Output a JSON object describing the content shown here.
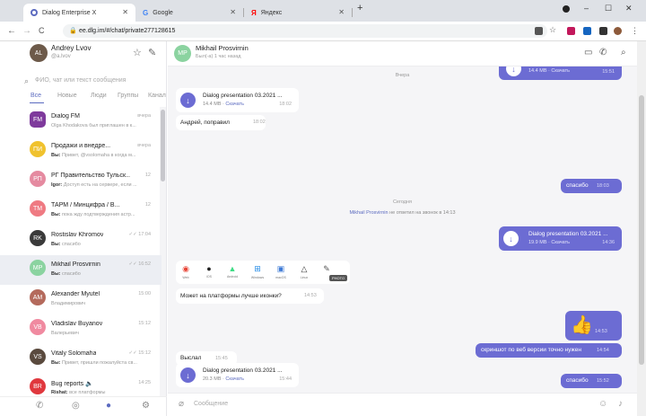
{
  "browser": {
    "tabs": [
      {
        "label": "Dialog Enterprise X",
        "fav_color": "#5c6bc0"
      },
      {
        "label": "Google",
        "fav_color": "#4285f4"
      },
      {
        "label": "Яндекс",
        "fav_color": "#ff0000"
      }
    ],
    "new_tab": "+",
    "url": "ee.dlg.im/#/chat/private277128615",
    "window_controls": {
      "min": "–",
      "max": "☐",
      "close": "✕"
    },
    "nav": {
      "back": "←",
      "forward": "→",
      "reload": "C"
    }
  },
  "me": {
    "name": "Andrey Lvov",
    "handle": "@a.lvov",
    "initials": "AL",
    "avatar_color": "#6d5a4a"
  },
  "search": {
    "placeholder": "ФИО, чат или текст сообщения"
  },
  "filters": [
    {
      "label": "Все",
      "active": true
    },
    {
      "label": "Новые",
      "active": false
    },
    {
      "label": "Люди",
      "active": false
    },
    {
      "label": "Группы",
      "active": false
    },
    {
      "label": "Канал",
      "active": false
    }
  ],
  "chats": [
    {
      "name": "Dialog FM",
      "preview": "Olga Khodakova был приглашен в к...",
      "time": "вчера",
      "initials": "FM",
      "color": "#7e3a9c"
    },
    {
      "name": "Продажи и внедре...",
      "preview_author": "Вы:",
      "preview": "Привет, @vsolomaha в когда м...",
      "time": "вчера",
      "initials": "ПИ",
      "color": "#f0c22e"
    },
    {
      "name": "РГ Правительство Тульск...",
      "preview_author": "Igor:",
      "preview": "Доступ есть на сервере, если ...",
      "time": "12",
      "initials": "РП",
      "color": "#e58aa0"
    },
    {
      "name": "ТАРМ / Минцифра / В...",
      "preview_author": "Вы:",
      "preview": "пока жду подтверждения астр...",
      "time": "12",
      "initials": "ТМ",
      "color": "#ef7a82"
    },
    {
      "name": "Rostislav Khromov",
      "preview_author": "Вы:",
      "preview": "спасибо",
      "time": "17:04",
      "initials": "RK",
      "color": "#3a3a3a"
    },
    {
      "name": "Mikhail Prosvirnin",
      "preview_author": "Вы:",
      "preview": "спасибо",
      "time": "16:52",
      "initials": "MP",
      "color": "#8bd3a0"
    },
    {
      "name": "Alexander Myutel",
      "preview": "Владимирович",
      "time": "15:00",
      "initials": "AM",
      "color": "#b46a5c"
    },
    {
      "name": "Vladislav Buyanov",
      "preview": "Валерьевич",
      "time": "15:12",
      "initials": "VB",
      "color": "#f08aa0"
    },
    {
      "name": "Vitaly Solomaha",
      "preview_author": "Вы:",
      "preview": "Привет, пришли пожалуйста св...",
      "time": "15:12",
      "initials": "VS",
      "color": "#5a4a3e"
    },
    {
      "name": "Bug reports",
      "preview_author": "Rishat:",
      "preview": "все платформы",
      "time": "14:25",
      "initials": "BR",
      "color": "#e0383e"
    }
  ],
  "thread": {
    "name": "Mikhail Prosvirnin",
    "status": "Был(-а) 1 час назад",
    "initials": "MP",
    "avatar_color": "#8bd3a0"
  },
  "messages": {
    "top_out_file": {
      "size": "14.4 MB",
      "download": "Скачать",
      "time": "15:51"
    },
    "date1": "Вчера",
    "in_file1": {
      "name": "Dialog presentation 03.2021 ...",
      "size": "14.4 MB",
      "download": "Скачать",
      "time": "18:02"
    },
    "in_text1": {
      "text": "Андрей, поправил",
      "time": "18:02"
    },
    "out_text1": {
      "text": "спасибо",
      "time": "18:03"
    },
    "date2": "Сегодня",
    "service": {
      "author": "Mikhail Prosvirnin",
      "text": "не ответил на звонок в 14:13"
    },
    "out_file2": {
      "name": "Dialog presentation 03.2021 ...",
      "size": "19.9 MB",
      "download": "Скачать",
      "time": "14:36"
    },
    "platforms": [
      {
        "glyph": "◉",
        "label": "Web",
        "color": "#e84335"
      },
      {
        "glyph": "",
        "label": "iOS",
        "color": "#222"
      },
      {
        "glyph": "▲",
        "label": "Android",
        "color": "#3ddc84"
      },
      {
        "glyph": "⊞",
        "label": "Windows",
        "color": "#1e88e5"
      },
      {
        "glyph": "▣",
        "label": "macOS",
        "color": "#3f7bd6"
      },
      {
        "glyph": "△",
        "label": "Linux",
        "color": "#333"
      },
      {
        "glyph": "✎",
        "label": "",
        "color": "#555"
      }
    ],
    "tooltip": "PHOTO",
    "in_text2": {
      "text": "Может на платформы лучше иконки?",
      "time": "14:53"
    },
    "out_emoji": {
      "glyph": "👍",
      "time": "14:53"
    },
    "out_text2": {
      "text": "скриншот по веб версии точно нужен",
      "time": "14:54"
    },
    "in_file3": {
      "name": "Dialog presentation 03.2021 ...",
      "size": "20.3 MB",
      "download": "Скачать",
      "time": "15:44"
    },
    "in_text3": {
      "text": "Выслал",
      "time": "15:45"
    },
    "out_text3": {
      "text": "спасибо",
      "time": "15:52"
    }
  },
  "composer": {
    "placeholder": "Сообщение"
  },
  "colors": {
    "accent": "#6c6cd3",
    "sidebar_selected": "#eceef3"
  }
}
